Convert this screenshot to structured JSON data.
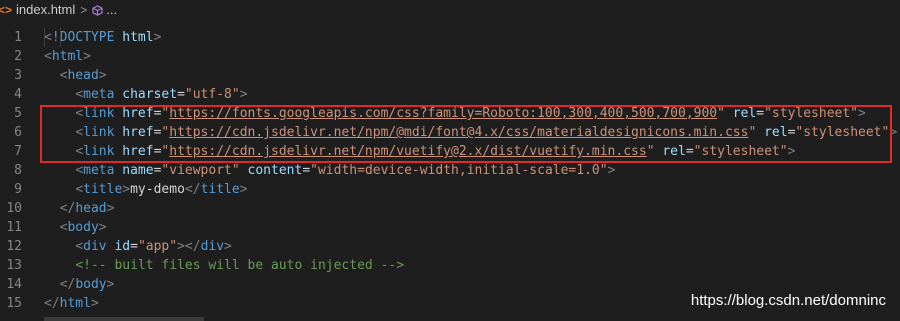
{
  "breadcrumb": {
    "icon": "<>",
    "file": "index.html",
    "separator": ">",
    "element": "..."
  },
  "editor": {
    "lines": [
      {
        "n": "1"
      },
      {
        "n": "2"
      },
      {
        "n": "3"
      },
      {
        "n": "4"
      },
      {
        "n": "5"
      },
      {
        "n": "6"
      },
      {
        "n": "7"
      },
      {
        "n": "8"
      },
      {
        "n": "9"
      },
      {
        "n": "10"
      },
      {
        "n": "11"
      },
      {
        "n": "12"
      },
      {
        "n": "13"
      },
      {
        "n": "14"
      },
      {
        "n": "15"
      }
    ],
    "tokens": {
      "l1_tag": "!DOCTYPE",
      "l1_attr": "html",
      "html": "html",
      "head": "head",
      "meta": "meta",
      "charset": "charset",
      "charset_val": "\"utf-8\"",
      "link": "link",
      "href": "href",
      "rel": "rel",
      "stylesheet": "\"stylesheet\"",
      "url1": "https://fonts.googleapis.com/css?family=Roboto:100,300,400,500,700,900",
      "url2": "https://cdn.jsdelivr.net/npm/@mdi/font@4.x/css/materialdesignicons.min.css",
      "url3": "https://cdn.jsdelivr.net/npm/vuetify@2.x/dist/vuetify.min.css",
      "name": "name",
      "viewport": "\"viewport\"",
      "content": "content",
      "content_val": "\"width=device-width,initial-scale=1.0\"",
      "title": "title",
      "title_text": "my-demo",
      "body": "body",
      "div": "div",
      "id": "id",
      "id_val": "\"app\"",
      "comment": "<!-- built files will be auto injected -->"
    }
  },
  "watermark": "https://blog.csdn.net/domninc",
  "colors": {
    "background": "#1e1e1e",
    "tag": "#569cd6",
    "attribute": "#9cdcfe",
    "string": "#ce9178",
    "comment": "#6a9955",
    "highlight": "#e02a2a"
  }
}
